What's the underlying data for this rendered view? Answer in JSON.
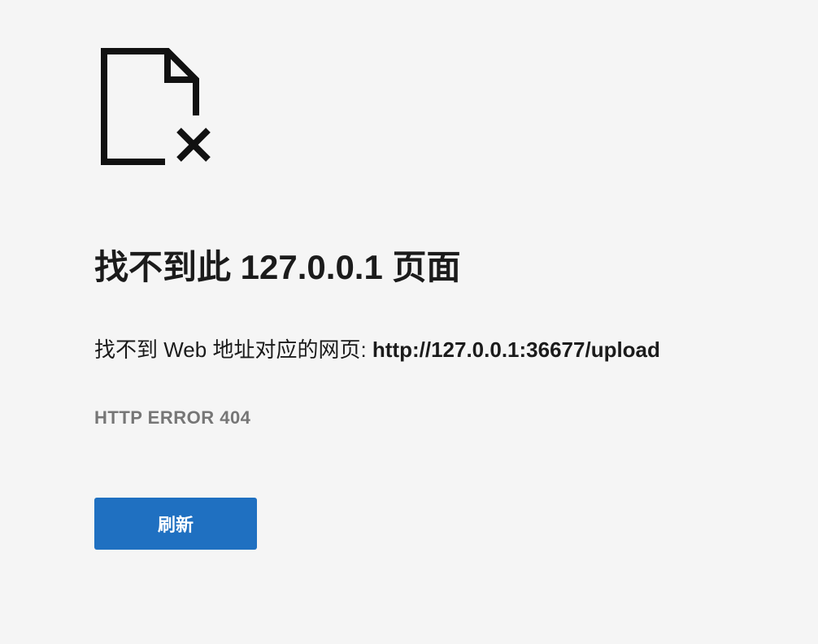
{
  "page": {
    "background": "#f5f5f5"
  },
  "icon": {
    "name": "page-not-found-icon"
  },
  "error": {
    "title": "找不到此 127.0.0.1 页面",
    "message_prefix": "找不到 Web 地址对应的网页: ",
    "url": "http://127.0.0.1:36677/upload",
    "code": "HTTP ERROR 404"
  },
  "actions": {
    "reload_label": "刷新",
    "reload_color": "#1f70c1"
  }
}
